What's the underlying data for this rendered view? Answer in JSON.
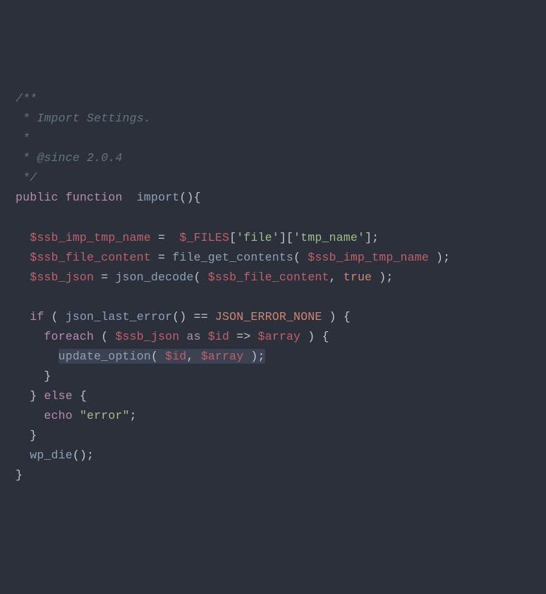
{
  "code": {
    "l1": "/**",
    "l2a": " * ",
    "l2b": "Import Settings.",
    "l3": " *",
    "l4a": " * ",
    "l4b": "@since",
    "l4c": " 2.0.4",
    "l5": " */",
    "l6_public": "public",
    "l6_function": "function",
    "l6_name": "import",
    "l6_paren": "(){",
    "l8_var1": "$ssb_imp_tmp_name",
    "l8_eq": " =  ",
    "l8_files": "$_FILES",
    "l8_b1": "[",
    "l8_s1": "'file'",
    "l8_b2": "][",
    "l8_s2": "'tmp_name'",
    "l8_b3": "];",
    "l9_var1": "$ssb_file_content",
    "l9_eq": " = ",
    "l9_fn": "file_get_contents",
    "l9_p1": "( ",
    "l9_var2": "$ssb_imp_tmp_name",
    "l9_p2": " );",
    "l10_var1": "$ssb_json",
    "l10_eq": " = ",
    "l10_fn": "json_decode",
    "l10_p1": "( ",
    "l10_var2": "$ssb_file_content",
    "l10_c": ", ",
    "l10_true": "true",
    "l10_p2": " );",
    "l12_if": "if",
    "l12_p1": " ( ",
    "l12_fn": "json_last_error",
    "l12_pp": "()",
    "l12_eqeq": " == ",
    "l12_const": "JSON_ERROR_NONE",
    "l12_p2": " ) {",
    "l13_foreach": "foreach",
    "l13_p1": " ( ",
    "l13_var1": "$ssb_json",
    "l13_as": " as ",
    "l13_var2": "$id",
    "l13_arrow": " => ",
    "l13_var3": "$array",
    "l13_p2": " ) {",
    "l14_fn": "update_option",
    "l14_p1": "( ",
    "l14_var1": "$id",
    "l14_c": ", ",
    "l14_var2": "$array",
    "l14_p2": " );",
    "l15": "}",
    "l16a": "} ",
    "l16_else": "else",
    "l16b": " {",
    "l17_echo": "echo",
    "l17_sp": " ",
    "l17_str": "\"error\"",
    "l17_sc": ";",
    "l18": "}",
    "l19_fn": "wp_die",
    "l19_p": "();",
    "l20": "}"
  }
}
